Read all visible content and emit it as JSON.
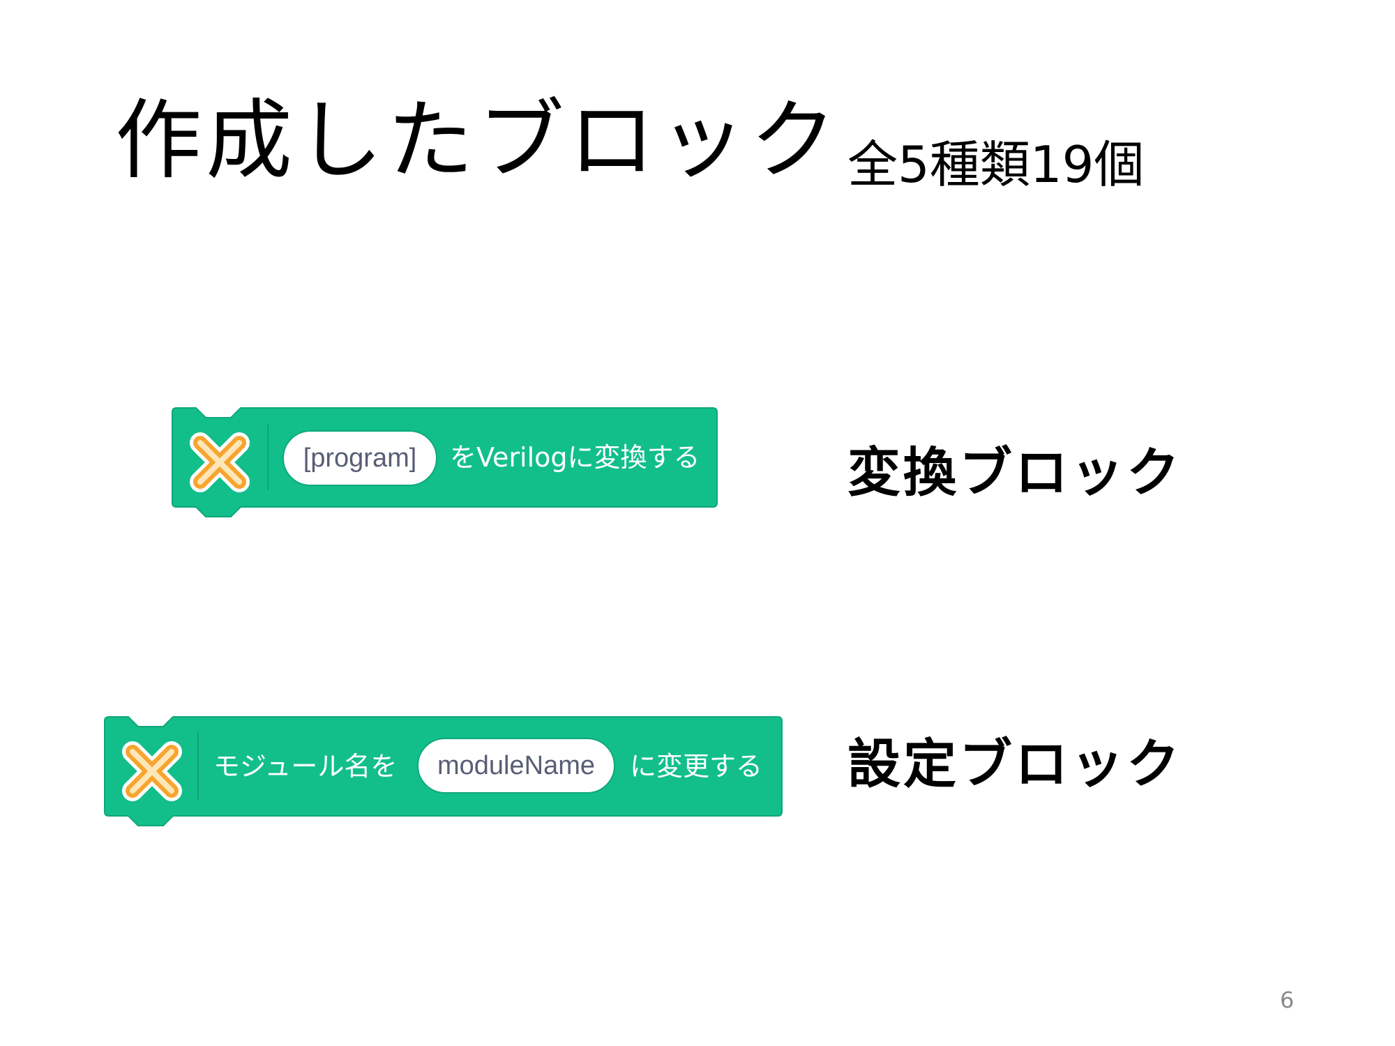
{
  "title": "作成したブロック",
  "subtitle": "全5種類19個",
  "blocks": [
    {
      "label": "変換ブロック",
      "input_value": "[program]",
      "text_after": "をVerilogに変換する",
      "icon": "orange-x-extension-icon"
    },
    {
      "label": "設定ブロック",
      "text_before": "モジュール名を",
      "input_value": "moduleName",
      "text_after": "に変更する",
      "icon": "orange-x-extension-icon"
    }
  ],
  "page_number": "6",
  "colors": {
    "block_fill": "#12bf8b",
    "block_stroke": "#0ea77a",
    "icon_orange": "#f7a52f",
    "pill_text": "#575e75"
  }
}
